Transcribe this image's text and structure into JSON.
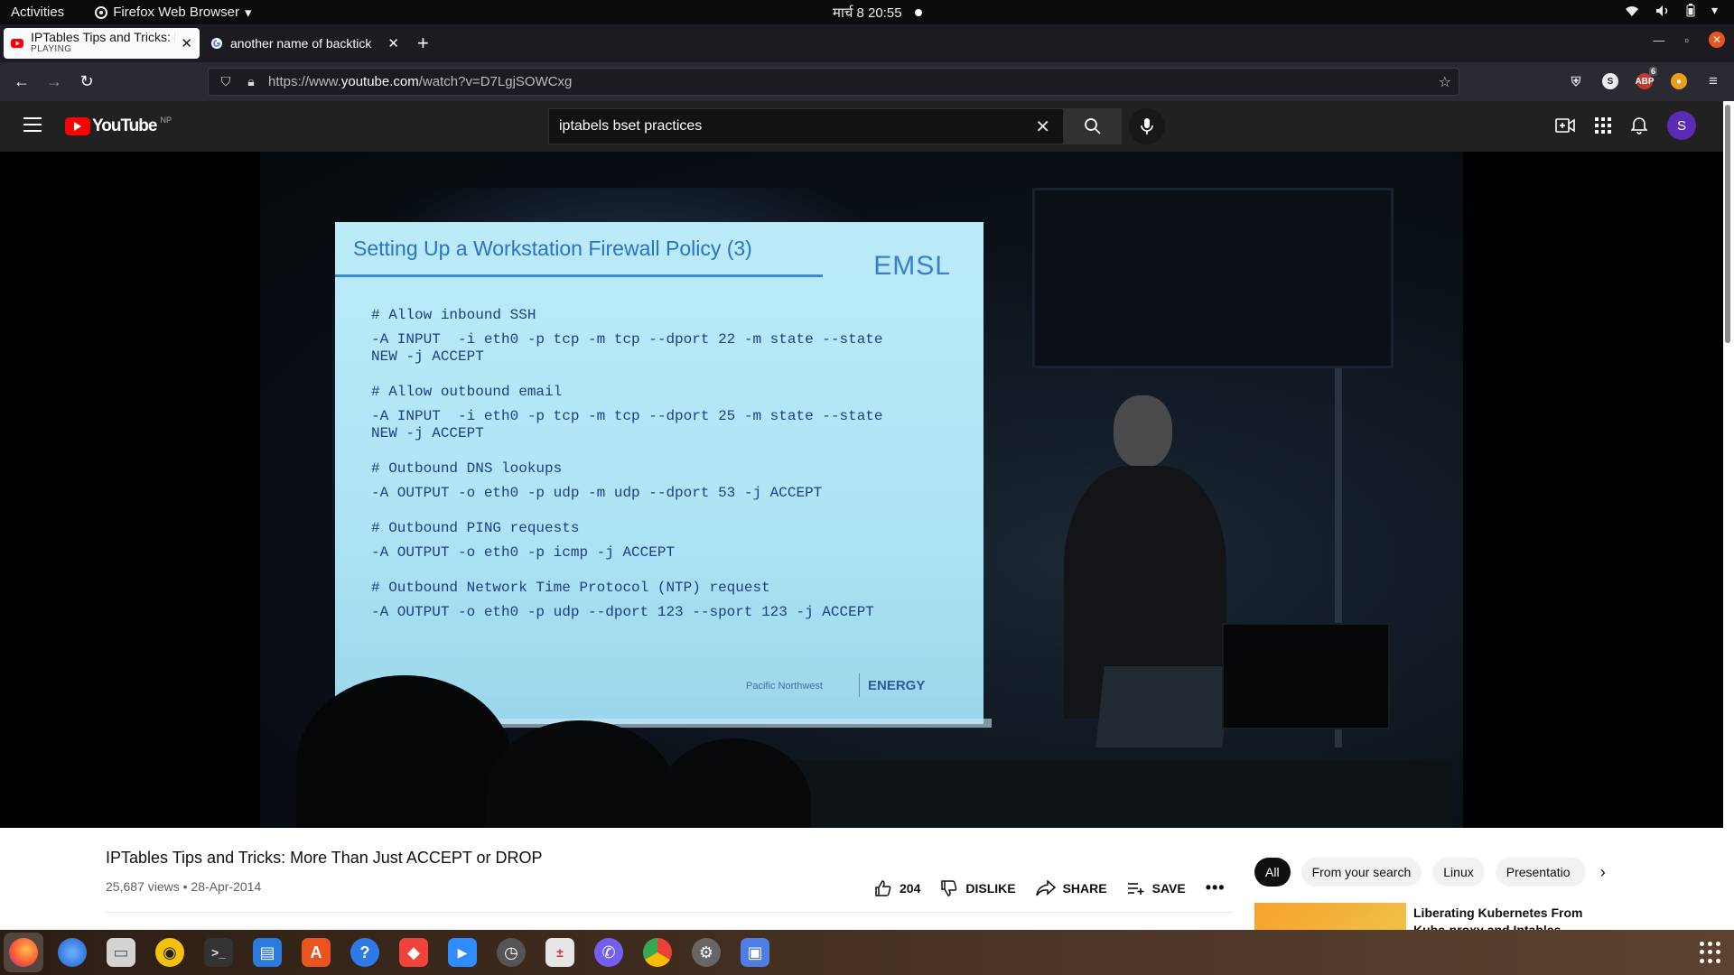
{
  "system": {
    "activities": "Activities",
    "app_menu": "Firefox Web Browser",
    "clock": "मार्च 8  20:55"
  },
  "tabs": [
    {
      "title": "IPTables Tips and Tricks: M",
      "status": "PLAYING",
      "active": true
    },
    {
      "title": "another name of backtick",
      "active": false
    }
  ],
  "browser": {
    "url_prefix": "https://www.",
    "url_domain": "youtube.com",
    "url_path": "/watch?v=D7LgjSOWCxg",
    "extension_badge": "6"
  },
  "youtube": {
    "logo": "YouTube",
    "country": "NP",
    "search_query": "iptabels bset practices",
    "avatar_letter": "S"
  },
  "slide": {
    "title": "Setting Up a Workstation Firewall Policy (3)",
    "logo": "EMSL",
    "blocks": [
      {
        "comment": "# Allow inbound SSH",
        "lines": [
          "-A INPUT  -i eth0 -p tcp -m tcp --dport 22 -m state --state",
          "NEW -j ACCEPT"
        ]
      },
      {
        "comment": "# Allow outbound email",
        "lines": [
          "-A INPUT  -i eth0 -p tcp -m tcp --dport 25 -m state --state",
          "NEW -j ACCEPT"
        ]
      },
      {
        "comment": "# Outbound DNS lookups",
        "lines": [
          "-A OUTPUT -o eth0 -p udp -m udp --dport 53 -j ACCEPT"
        ]
      },
      {
        "comment": "# Outbound PING requests",
        "lines": [
          "-A OUTPUT -o eth0 -p icmp -j ACCEPT"
        ]
      },
      {
        "comment": "# Outbound Network Time Protocol (NTP) request",
        "lines": [
          "-A OUTPUT -o eth0 -p udp --dport 123 --sport 123 -j ACCEPT"
        ]
      }
    ],
    "footer_left": "Pacific Northwest",
    "footer_right": "ENERGY"
  },
  "video": {
    "title": "IPTables Tips and Tricks: More Than Just ACCEPT or DROP",
    "views": "25,687 views",
    "date": "28-Apr-2014",
    "likes": "204",
    "dislike_label": "DISLIKE",
    "share_label": "SHARE",
    "save_label": "SAVE"
  },
  "chips": [
    "All",
    "From your search",
    "Linux",
    "Presentatio"
  ],
  "recommended": {
    "title_line1": "Liberating Kubernetes From",
    "title_line2": "Kube-proxy and Iptables"
  },
  "dock": [
    "firefox",
    "thunderbird",
    "files",
    "rhythmbox",
    "terminal",
    "writer",
    "software",
    "help",
    "anydesk",
    "zoom",
    "clocks",
    "calculator",
    "viber",
    "chrome",
    "settings",
    "screenshot"
  ]
}
